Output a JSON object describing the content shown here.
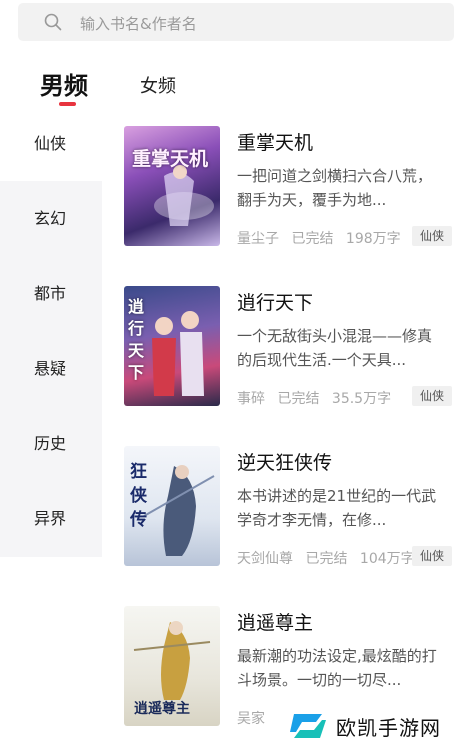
{
  "search": {
    "placeholder": "输入书名&作者名",
    "icon": "search-icon"
  },
  "tabs": [
    {
      "label": "男频",
      "active": true
    },
    {
      "label": "女频",
      "active": false
    }
  ],
  "accent_color": "#e8343f",
  "sidebar": {
    "items": [
      "仙侠",
      "玄幻",
      "都市",
      "悬疑",
      "历史",
      "异界"
    ],
    "active_index": 0
  },
  "books": [
    {
      "title": "重掌天机",
      "desc": "一把问道之剑横扫六合八荒，翻手为天，覆手为地...",
      "author": "量尘子",
      "status": "已完结",
      "words": "198万字",
      "tag": "仙侠",
      "cover_text": "重掌天机"
    },
    {
      "title": "逍行天下",
      "desc": "一个无敌街头小混混——修真的后现代生活.一个天具...",
      "author": "事碎",
      "status": "已完结",
      "words": "35.5万字",
      "tag": "仙侠",
      "cover_text": "逍行天下"
    },
    {
      "title": "逆天狂侠传",
      "desc": "本书讲述的是21世纪的一代武学奇才李无情，在修...",
      "author": "天剑仙尊",
      "status": "已完结",
      "words": "104万字",
      "tag": "仙侠",
      "cover_text": "狂侠传"
    },
    {
      "title": "逍遥尊主",
      "desc": "最新潮的功法设定,最炫酷的打斗场景。一切的一切尽...",
      "author": "吴家",
      "status": "",
      "words": "",
      "tag": "",
      "cover_text": "逍遥尊主"
    }
  ],
  "watermark": {
    "text": "欧凯手游网"
  }
}
